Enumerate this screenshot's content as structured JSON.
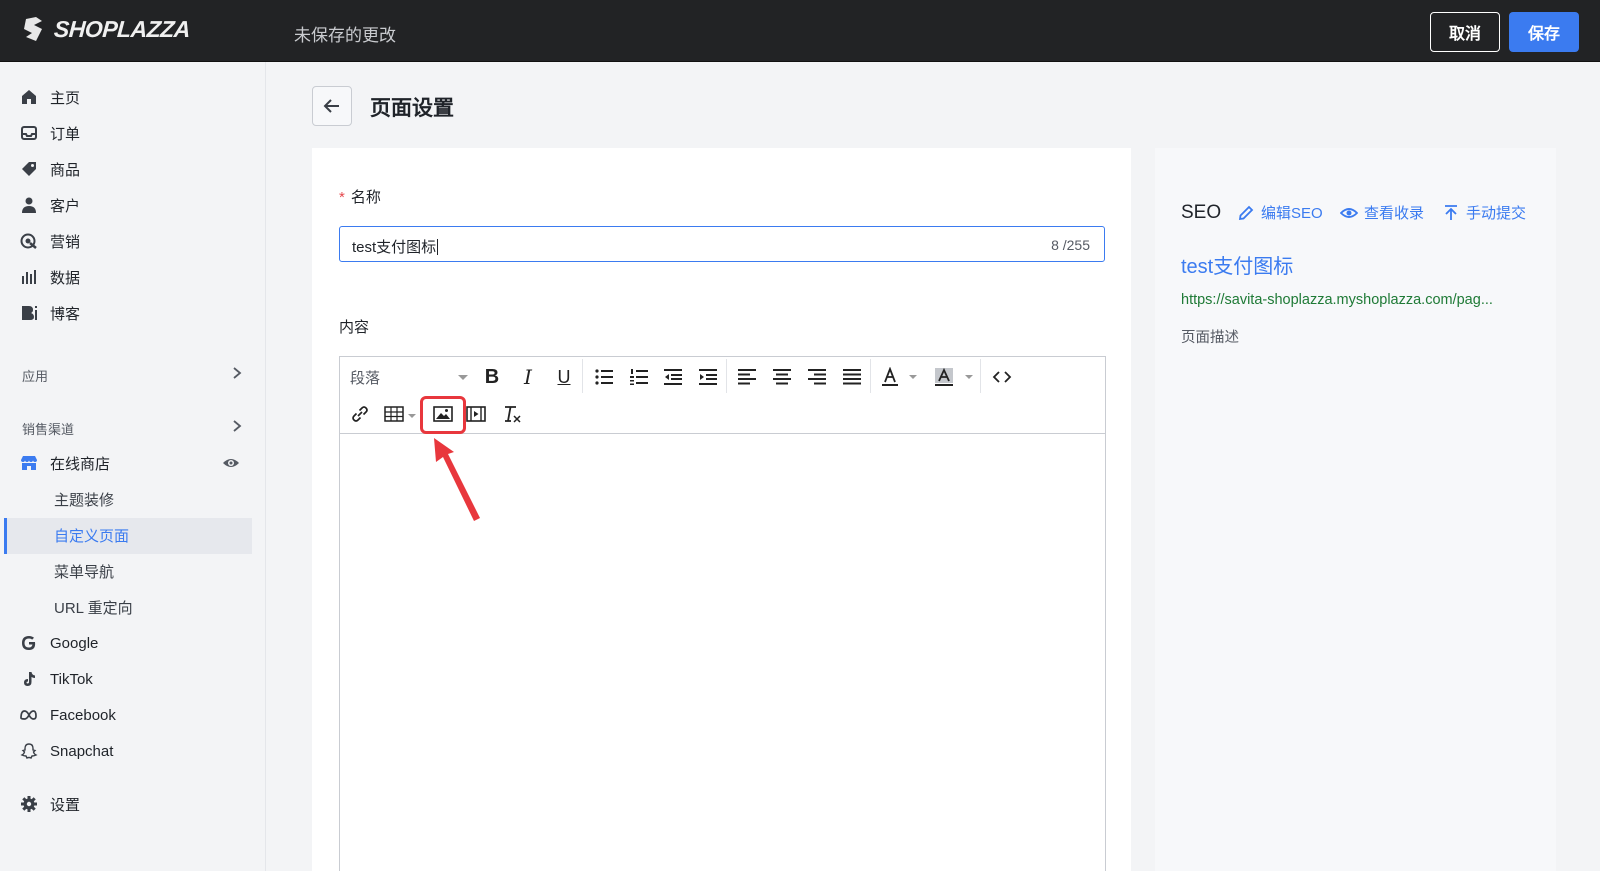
{
  "topbar": {
    "logo_text": "SHOPLAZZA",
    "status": "未保存的更改",
    "cancel_label": "取消",
    "save_label": "保存",
    "accent_color": "#3b7bf0"
  },
  "sidebar": {
    "items": [
      {
        "label": "主页",
        "icon": "home-icon"
      },
      {
        "label": "订单",
        "icon": "inbox-icon"
      },
      {
        "label": "商品",
        "icon": "tag-icon"
      },
      {
        "label": "客户",
        "icon": "person-icon"
      },
      {
        "label": "营销",
        "icon": "target-icon"
      },
      {
        "label": "数据",
        "icon": "bar-chart-icon"
      },
      {
        "label": "博客",
        "icon": "blog-icon"
      }
    ],
    "apps_label": "应用",
    "channels_label": "销售渠道",
    "online_store": "在线商店",
    "sub_items": [
      "主题装修",
      "自定义页面",
      "菜单导航",
      "URL 重定向"
    ],
    "active_sub": "自定义页面",
    "channels": [
      {
        "label": "Google",
        "icon": "google-icon"
      },
      {
        "label": "TikTok",
        "icon": "tiktok-icon"
      },
      {
        "label": "Facebook",
        "icon": "meta-icon"
      },
      {
        "label": "Snapchat",
        "icon": "snapchat-icon"
      }
    ],
    "settings": "设置"
  },
  "page": {
    "title": "页面设置",
    "name_label": "名称",
    "name_value": "test支付图标",
    "name_count": "8 /255",
    "content_label": "内容",
    "paragraph_select": "段落"
  },
  "seo": {
    "title": "SEO",
    "edit_label": "编辑SEO",
    "view_label": "查看收录",
    "submit_label": "手动提交",
    "page_title": "test支付图标",
    "url": "https://savita-shoplazza.myshoplazza.com/pag...",
    "description": "页面描述"
  }
}
